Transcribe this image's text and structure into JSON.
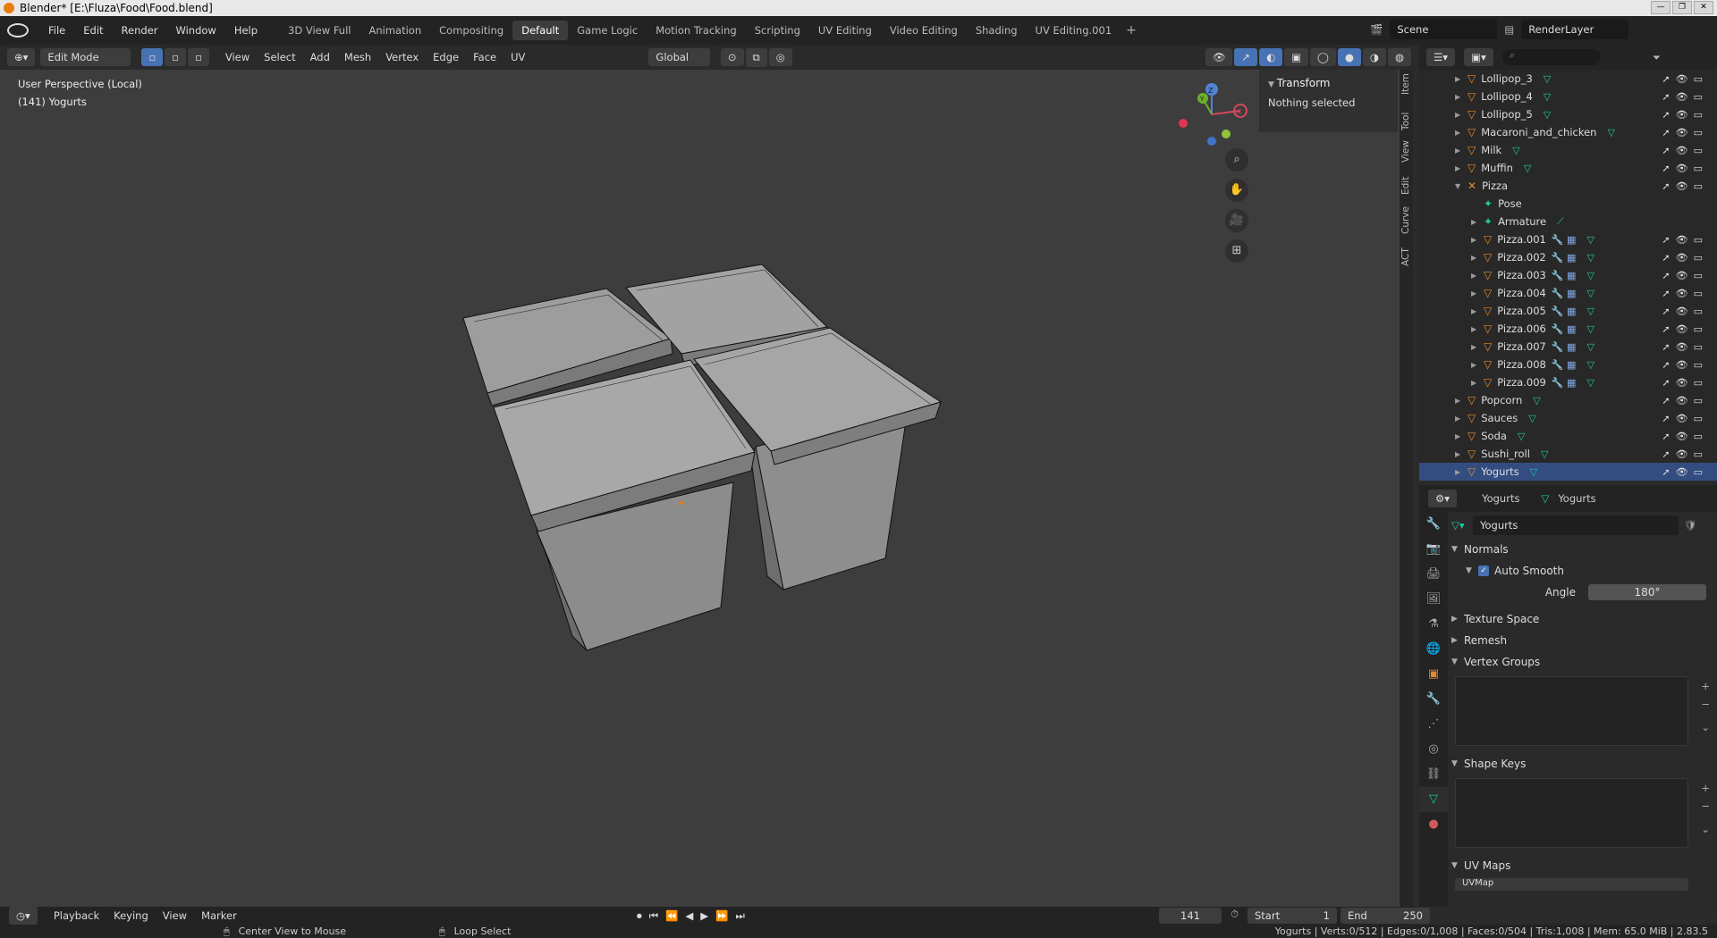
{
  "window": {
    "title": "Blender* [E:\\Fluza\\Food\\Food.blend]",
    "controls": [
      "—",
      "❐",
      "✕"
    ]
  },
  "menu": [
    "File",
    "Edit",
    "Render",
    "Window",
    "Help"
  ],
  "workspaces": [
    "3D View Full",
    "Animation",
    "Compositing",
    "Default",
    "Game Logic",
    "Motion Tracking",
    "Scripting",
    "UV Editing",
    "Video Editing",
    "Shading",
    "UV Editing.001"
  ],
  "active_workspace": "Default",
  "scene": "Scene",
  "render_layer": "RenderLayer",
  "viewport_header": {
    "mode": "Edit Mode",
    "menus": [
      "View",
      "Select",
      "Add",
      "Mesh",
      "Vertex",
      "Edge",
      "Face",
      "UV"
    ],
    "orientation": "Global"
  },
  "viewport": {
    "perspective": "User Perspective (Local)",
    "object_info": "(141) Yogurts",
    "gizmo_labels": [
      "X",
      "Y",
      "Z"
    ]
  },
  "npanel": {
    "header": "Transform",
    "body": "Nothing selected"
  },
  "side_tabs": [
    "Item",
    "Tool",
    "View",
    "Edit",
    "Curve",
    "ACT"
  ],
  "outliner": {
    "rows": [
      {
        "name": "Lollipop_3",
        "indent": 1,
        "type": "mesh"
      },
      {
        "name": "Lollipop_4",
        "indent": 1,
        "type": "mesh"
      },
      {
        "name": "Lollipop_5",
        "indent": 1,
        "type": "mesh"
      },
      {
        "name": "Macaroni_and_chicken",
        "indent": 1,
        "type": "mesh"
      },
      {
        "name": "Milk",
        "indent": 1,
        "type": "mesh"
      },
      {
        "name": "Muffin",
        "indent": 1,
        "type": "mesh"
      },
      {
        "name": "Pizza",
        "indent": 1,
        "type": "armature",
        "expanded": true
      },
      {
        "name": "Pose",
        "indent": 2,
        "type": "pose"
      },
      {
        "name": "Armature",
        "indent": 2,
        "type": "armdata"
      },
      {
        "name": "Pizza.001",
        "indent": 2,
        "type": "mesh"
      },
      {
        "name": "Pizza.002",
        "indent": 2,
        "type": "mesh"
      },
      {
        "name": "Pizza.003",
        "indent": 2,
        "type": "mesh"
      },
      {
        "name": "Pizza.004",
        "indent": 2,
        "type": "mesh"
      },
      {
        "name": "Pizza.005",
        "indent": 2,
        "type": "mesh"
      },
      {
        "name": "Pizza.006",
        "indent": 2,
        "type": "mesh"
      },
      {
        "name": "Pizza.007",
        "indent": 2,
        "type": "mesh"
      },
      {
        "name": "Pizza.008",
        "indent": 2,
        "type": "mesh"
      },
      {
        "name": "Pizza.009",
        "indent": 2,
        "type": "mesh"
      },
      {
        "name": "Popcorn",
        "indent": 1,
        "type": "mesh"
      },
      {
        "name": "Sauces",
        "indent": 1,
        "type": "mesh"
      },
      {
        "name": "Soda",
        "indent": 1,
        "type": "mesh"
      },
      {
        "name": "Sushi_roll",
        "indent": 1,
        "type": "mesh"
      },
      {
        "name": "Yogurts",
        "indent": 1,
        "type": "mesh",
        "selected": true
      }
    ]
  },
  "properties": {
    "breadcrumb_object": "Yogurts",
    "breadcrumb_data": "Yogurts",
    "mesh_name": "Yogurts",
    "normals_label": "Normals",
    "auto_smooth": "Auto Smooth",
    "angle_label": "Angle",
    "angle_value": "180°",
    "sections": [
      "Texture Space",
      "Remesh",
      "Vertex Groups",
      "Shape Keys",
      "UV Maps"
    ],
    "uvmap": "UVMap"
  },
  "timeline": {
    "menus": [
      "Playback",
      "Keying",
      "View",
      "Marker"
    ],
    "current_frame": "141",
    "start_label": "Start",
    "start": "1",
    "end_label": "End",
    "end": "250"
  },
  "status": {
    "hint1": "Center View to Mouse",
    "hint2": "Loop Select",
    "stats": "Yogurts | Verts:0/512 | Edges:0/1,008 | Faces:0/504 | Tris:1,008 | Mem: 65.0 MiB | 2.83.5"
  },
  "colors": {
    "accent": "#e87d0d",
    "selected_row": "#334d80",
    "mesh_icon": "#1fc89e"
  }
}
